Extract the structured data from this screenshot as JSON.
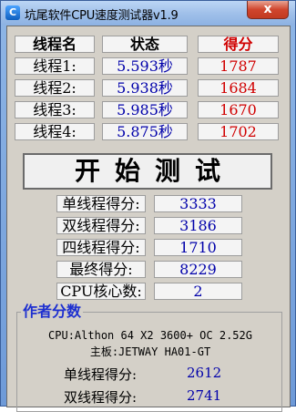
{
  "window": {
    "title": "坑尾软件CPU速度测试器v1.9",
    "app_icon_glyph": "C",
    "close_glyph": "x"
  },
  "header": {
    "thread": "线程名",
    "status": "状态",
    "score": "得分"
  },
  "threads": [
    {
      "name": "线程1:",
      "time": "5.593秒",
      "score": "1787"
    },
    {
      "name": "线程2:",
      "time": "5.938秒",
      "score": "1684"
    },
    {
      "name": "线程3:",
      "time": "5.985秒",
      "score": "1670"
    },
    {
      "name": "线程4:",
      "time": "5.875秒",
      "score": "1702"
    }
  ],
  "start_button": "开始测试",
  "summary": [
    {
      "label": "单线程得分:",
      "value": "3333"
    },
    {
      "label": "双线程得分:",
      "value": "3186"
    },
    {
      "label": "四线程得分:",
      "value": "1710"
    },
    {
      "label": "最终得分:",
      "value": "8229"
    },
    {
      "label": "CPU核心数:",
      "value": "2"
    }
  ],
  "author_scores": {
    "title": "作者分数",
    "cpu": "CPU:Althon 64 X2 3600+ OC 2.52G",
    "board": "主板:JETWAY HA01-GT",
    "rows": [
      {
        "label": "单线程得分:",
        "value": "2612"
      },
      {
        "label": "双线程得分:",
        "value": "2741"
      }
    ]
  },
  "colors": {
    "accent_red": "#d00000",
    "accent_blue": "#0000aa",
    "group_title": "#1d2fd0",
    "client_bg": "#d4d0c8"
  }
}
